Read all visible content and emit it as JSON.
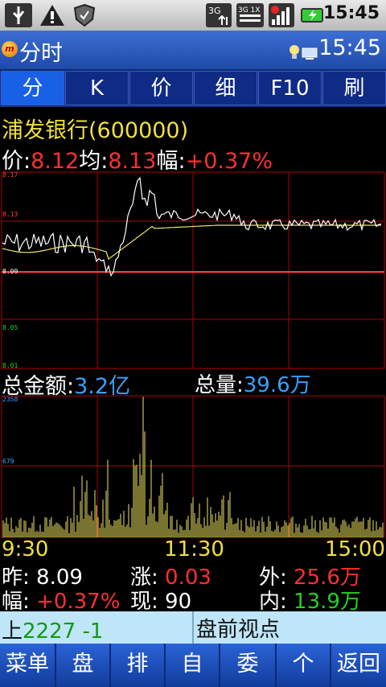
{
  "status_bar": {
    "time": "15:45",
    "icons": [
      "usb-icon",
      "warning-icon",
      "shield-icon",
      "3g-data-icon",
      "3g-1x-icon",
      "signal-icon",
      "battery-charging-icon"
    ]
  },
  "title_bar": {
    "title": "分时",
    "time": "15:45"
  },
  "tabs": [
    {
      "label": "分",
      "active": true
    },
    {
      "label": "K"
    },
    {
      "label": "价"
    },
    {
      "label": "细"
    },
    {
      "label": "F10"
    },
    {
      "label": "刷"
    }
  ],
  "quote": {
    "name": "浦发银行(600000)",
    "price_label": "价:",
    "price": "8.12",
    "avg_label": "均:",
    "avg": "8.13",
    "change_label": "幅:",
    "change_pct": "+0.37%"
  },
  "price_chart": {
    "y_ticks": [
      "8.17",
      "8.13",
      "8.09",
      "8.05",
      "8.01"
    ],
    "reference_price": 8.09,
    "price_color": "#ffffff",
    "avg_color": "#f0e860"
  },
  "amount": {
    "total_amount_label": "总金额:",
    "total_amount": "3.2亿",
    "total_volume_label": "总量:",
    "total_volume": "39.6万"
  },
  "volume_chart": {
    "y_ticks": [
      "2358",
      "679"
    ],
    "bar_color": "#f0e860"
  },
  "time_axis": [
    "9:30",
    "11:30",
    "15:00"
  ],
  "stats": {
    "prev_close_label": "昨:",
    "prev_close": "8.09",
    "rise_label": "涨:",
    "rise": "0.03",
    "outer_label": "外:",
    "outer": "25.6万",
    "change_label": "幅:",
    "change": "+0.37%",
    "now_label": "现:",
    "now": "90",
    "inner_label": "内:",
    "inner": "13.9万"
  },
  "ticker": {
    "index_prefix": "上",
    "index_value": "2227",
    "index_change": "-1",
    "news": "盘前视点"
  },
  "menu": [
    "菜单",
    "盘",
    "排",
    "自",
    "委",
    "个",
    "返回"
  ],
  "colors": {
    "up": "#ff3030",
    "down": "#22d022",
    "accent_blue": "#3aa0ff",
    "tab_active": "#1860e6"
  }
}
